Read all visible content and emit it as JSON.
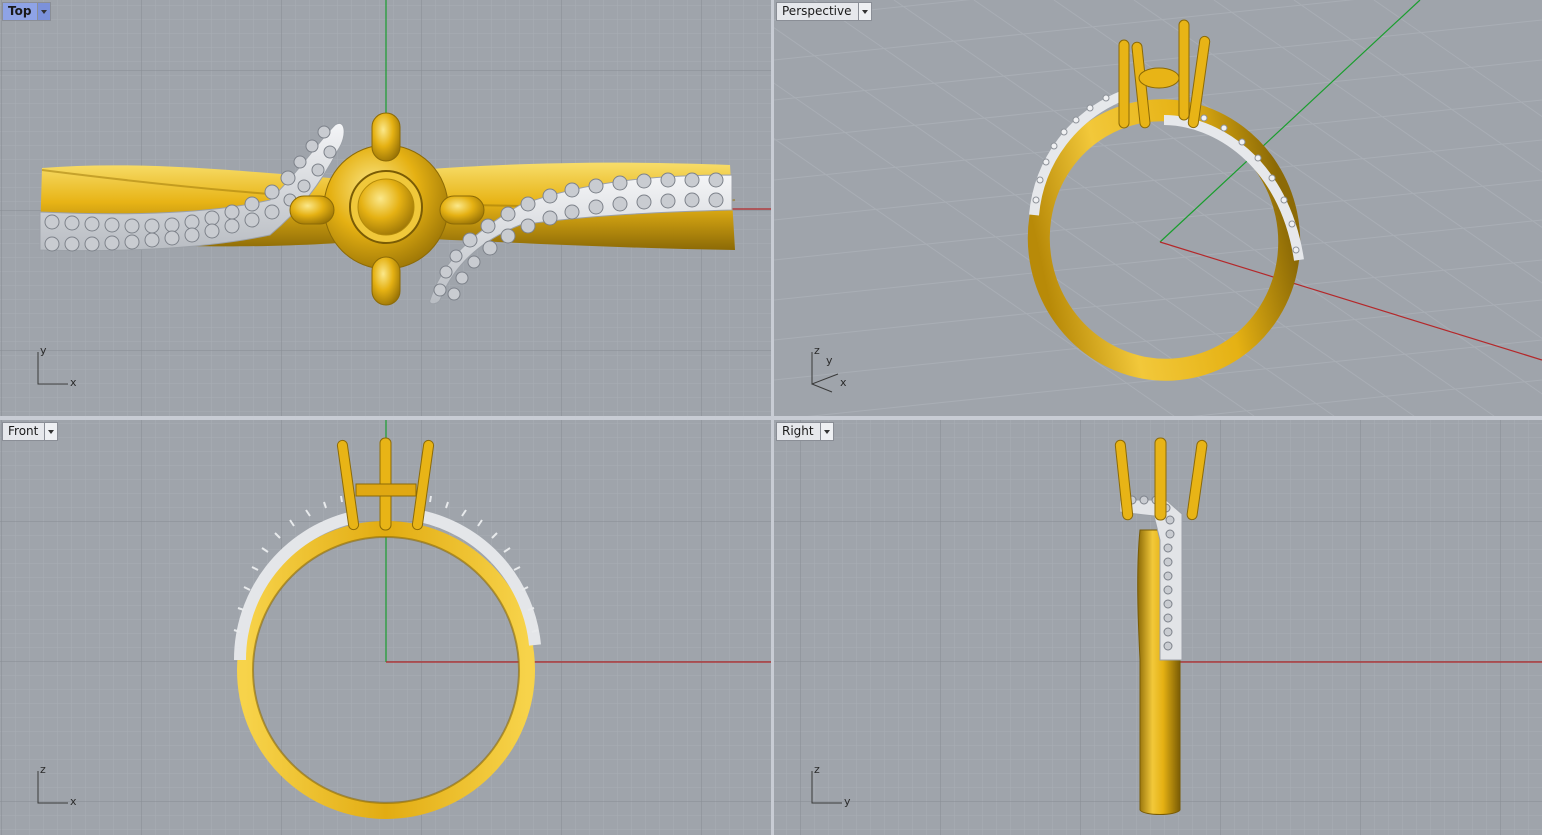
{
  "viewports": {
    "top": {
      "label": "Top",
      "active": true,
      "axes": {
        "v": "y",
        "h": "x"
      }
    },
    "perspective": {
      "label": "Perspective",
      "active": false,
      "axes": {
        "up": "z",
        "depth": "y",
        "h": "x"
      }
    },
    "front": {
      "label": "Front",
      "active": false,
      "axes": {
        "v": "z",
        "h": "x"
      }
    },
    "right": {
      "label": "Right",
      "active": false,
      "axes": {
        "v": "z",
        "h": "y"
      }
    }
  },
  "colors": {
    "viewport_bg": "#9fa4ab",
    "grid_minor": "#a9aeb5",
    "grid_major": "#878c93",
    "axis_x": "#b4282a",
    "axis_y": "#1a9e2e",
    "gold": "#e8b416",
    "gold_dark": "#8c6a06",
    "gold_light": "#f7dd6a",
    "silver": "#dcdfe3",
    "silver_dark": "#9ca1a8",
    "active_label": "#8ea3e6"
  },
  "model": "ring-with-prong-head-and-pave-band"
}
